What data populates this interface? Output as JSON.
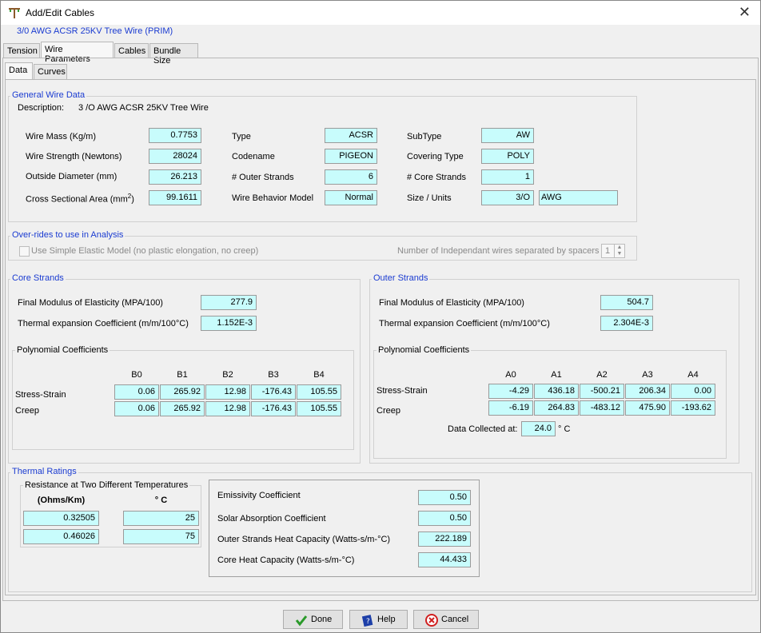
{
  "window": {
    "title": "Add/Edit Cables",
    "subtitle": "3/0 AWG ACSR 25KV Tree Wire (PRIM)"
  },
  "tabs": [
    "Tension",
    "Wire Parameters",
    "Cables",
    "Bundle Size"
  ],
  "subtabs": [
    "Data",
    "Curves"
  ],
  "general": {
    "title": "General Wire Data",
    "description_label": "Description:",
    "description_value": "3 /O AWG ACSR 25KV Tree Wire",
    "wire_mass_label": "Wire Mass (Kg/m)",
    "wire_mass": "0.7753",
    "wire_strength_label": "Wire Strength (Newtons)",
    "wire_strength": "28024",
    "outside_diameter_label": "Outside Diameter (mm)",
    "outside_diameter": "26.213",
    "cross_section_label": "Cross Sectional Area (mm",
    "cross_section_sup": "2",
    "cross_section_tail": ")",
    "cross_section": "99.1611",
    "type_label": "Type",
    "type": "ACSR",
    "codename_label": "Codename",
    "codename": "PIGEON",
    "outer_strands_label": "# Outer Strands",
    "outer_strands": "6",
    "behavior_label": "Wire Behavior Model",
    "behavior": "Normal",
    "subtype_label": "SubType",
    "subtype": "AW",
    "covering_label": "Covering Type",
    "covering": "POLY",
    "core_strands_label": "# Core Strands",
    "core_strands": "1",
    "size_label": "Size / Units",
    "size": "3/O",
    "units": "AWG"
  },
  "overrides": {
    "title": "Over-rides to use in Analysis",
    "simple_elastic_label": "Use Simple Elastic Model (no plastic elongation, no creep)",
    "independent_label": "Number of Independant wires separated by spacers",
    "independent_value": "1"
  },
  "core": {
    "title": "Core Strands",
    "modulus_label": "Final Modulus of Elasticity (MPA/100)",
    "modulus": "277.9",
    "thermal_label": "Thermal expansion Coefficient (m/m/100°C)",
    "thermal": "1.152E-3",
    "poly_title": "Polynomial Coefficients",
    "headers": [
      "B0",
      "B1",
      "B2",
      "B3",
      "B4"
    ],
    "rows": [
      {
        "label": "Stress-Strain",
        "values": [
          "0.06",
          "265.92",
          "12.98",
          "-176.43",
          "105.55"
        ]
      },
      {
        "label": "Creep",
        "values": [
          "0.06",
          "265.92",
          "12.98",
          "-176.43",
          "105.55"
        ]
      }
    ]
  },
  "outer": {
    "title": "Outer Strands",
    "modulus_label": "Final Modulus of Elasticity (MPA/100)",
    "modulus": "504.7",
    "thermal_label": "Thermal expansion Coefficient (m/m/100°C)",
    "thermal": "2.304E-3",
    "poly_title": "Polynomial Coefficients",
    "headers": [
      "A0",
      "A1",
      "A2",
      "A3",
      "A4"
    ],
    "rows": [
      {
        "label": "Stress-Strain",
        "values": [
          "-4.29",
          "436.18",
          "-500.21",
          "206.34",
          "0.00"
        ]
      },
      {
        "label": "Creep",
        "values": [
          "-6.19",
          "264.83",
          "-483.12",
          "475.90",
          "-193.62"
        ]
      }
    ],
    "collected_label": "Data Collected at:",
    "collected": "24.0",
    "collected_unit": "° C"
  },
  "thermal": {
    "title": "Thermal Ratings",
    "resistance_title": "Resistance at Two Different Temperatures",
    "ohms_header": "(Ohms/Km)",
    "deg_header": "° C",
    "r1": "0.32505",
    "t1": "25",
    "r2": "0.46026",
    "t2": "75",
    "emissivity_label": "Emissivity Coefficient",
    "emissivity": "0.50",
    "solar_label": "Solar Absorption Coefficient",
    "solar": "0.50",
    "outer_heat_label": "Outer Strands Heat Capacity (Watts-s/m-°C)",
    "outer_heat": "222.189",
    "core_heat_label": "Core Heat Capacity (Watts-s/m-°C)",
    "core_heat": "44.433"
  },
  "buttons": {
    "done": "Done",
    "help": "Help",
    "cancel": "Cancel"
  },
  "colors": {
    "field": "#c8fcfc",
    "title_blue": "#1a3bd1"
  }
}
